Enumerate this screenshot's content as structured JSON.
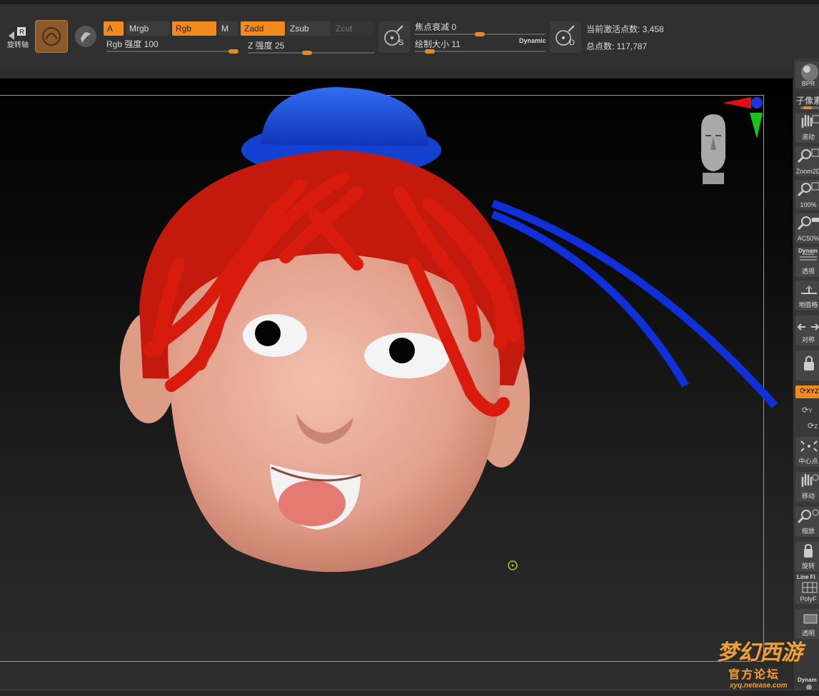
{
  "toolbar": {
    "rotate_label": "旋转轴",
    "channels": {
      "a": "A",
      "mrgb": "Mrgb",
      "rgb": "Rgb",
      "m": "M",
      "zadd": "Zadd",
      "zsub": "Zsub",
      "zcut": "Zcut"
    },
    "rgb_intensity": {
      "label": "Rgb 强度 100",
      "value": 100,
      "max": 100
    },
    "z_intensity": {
      "label": "Z 强度 25",
      "value": 25,
      "max": 100
    },
    "focal_shift": {
      "label": "焦点衰减 0",
      "value": 0
    },
    "draw_size": {
      "label": "绘制大小 11",
      "value": 11
    },
    "dynamic_label": "Dynamic",
    "s_badge": "S",
    "d_badge": "D",
    "active_points": "当前激活点数: 3,458",
    "total_points": "总点数: 117,787"
  },
  "right_shelf": {
    "bpr": "BPR",
    "subpixel": "子像素",
    "buttons": [
      {
        "label": "滚动",
        "icon": "hand-scroll-icon"
      },
      {
        "label": "Zoom2D",
        "icon": "zoom-2d-icon"
      },
      {
        "label": "100%",
        "icon": "zoom-100-icon"
      },
      {
        "label": "AC50%",
        "icon": "zoom-ac50-icon"
      },
      {
        "label": "透视",
        "top_label": "Dynam",
        "icon": "perspective-icon"
      },
      {
        "label": "地面格",
        "icon": "floor-grid-icon"
      },
      {
        "label": "对称",
        "icon": "symmetry-icon"
      },
      {
        "label": "",
        "icon": "lock-camera-icon"
      },
      {
        "label": "XYZ",
        "icon": "xyz-rotate-icon"
      },
      {
        "label": "Y",
        "icon": "y-rotate-icon"
      },
      {
        "label": "Z",
        "icon": "z-rotate-icon"
      },
      {
        "label": "中心点",
        "icon": "center-point-icon"
      },
      {
        "label": "移动",
        "icon": "move-icon"
      },
      {
        "label": "缩放",
        "icon": "scale-icon"
      },
      {
        "label": "旋转",
        "icon": "rotate-icon"
      },
      {
        "label": "PolyF",
        "top_label": "Line Fi",
        "icon": "polyframe-icon"
      },
      {
        "label": "透明",
        "icon": "transparency-icon"
      },
      {
        "label": "Dynam",
        "icon": "dynamic-icon"
      }
    ]
  },
  "watermark": {
    "title": "梦幻西游",
    "subtitle": "官方论坛",
    "url": "xyq.netease.com"
  },
  "colors": {
    "accent": "#f28a1e",
    "hair": "#d61a0c",
    "hat": "#1746d6",
    "skin": "#e9a895"
  }
}
